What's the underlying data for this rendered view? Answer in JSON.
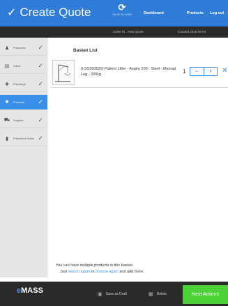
{
  "header": {
    "title": "Create Quote",
    "sync_timestamp": "03-08-15 14:53",
    "nav": {
      "dashboard": "Dashboard",
      "products": "Products",
      "logout": "Log out"
    }
  },
  "subheader": {
    "order_label": "Order ID",
    "order_value": "New Quote",
    "created": "Created 2015-08-04"
  },
  "sidebar": {
    "items": [
      {
        "label": "Prescriber",
        "icon": "person-icon"
      },
      {
        "label": "Client",
        "icon": "id-card-icon"
      },
      {
        "label": "Discharge",
        "icon": "medical-cross-icon"
      },
      {
        "label": "Products",
        "icon": "box-icon",
        "active": true
      },
      {
        "label": "Supplier",
        "icon": "truck-icon"
      },
      {
        "label": "Prescriber Notes",
        "icon": "folder-icon"
      }
    ]
  },
  "main": {
    "basket_title": "Basket List",
    "items": [
      {
        "name": "(LSS390620) Patient Lifter - Aspire 200 - Steel - Manual Leg - 200kg",
        "quantity": "1"
      }
    ],
    "footnote": {
      "line1": "You can have multiple products in this basket.",
      "just": "Just",
      "search_again": "search again",
      "or": "or",
      "browse_again": "browse again",
      "and_add_more": "and add more."
    }
  },
  "footer": {
    "logo_e": "e",
    "logo_rest": "MASS",
    "save_draft": "Save as Draft",
    "delete": "Delete",
    "next_actions": "Next Actions"
  },
  "colors": {
    "header_blue": "#2f7dd8",
    "accent_blue": "#3a8fe8",
    "next_green": "#4cd137",
    "footer_dark": "#2a2a2a"
  }
}
